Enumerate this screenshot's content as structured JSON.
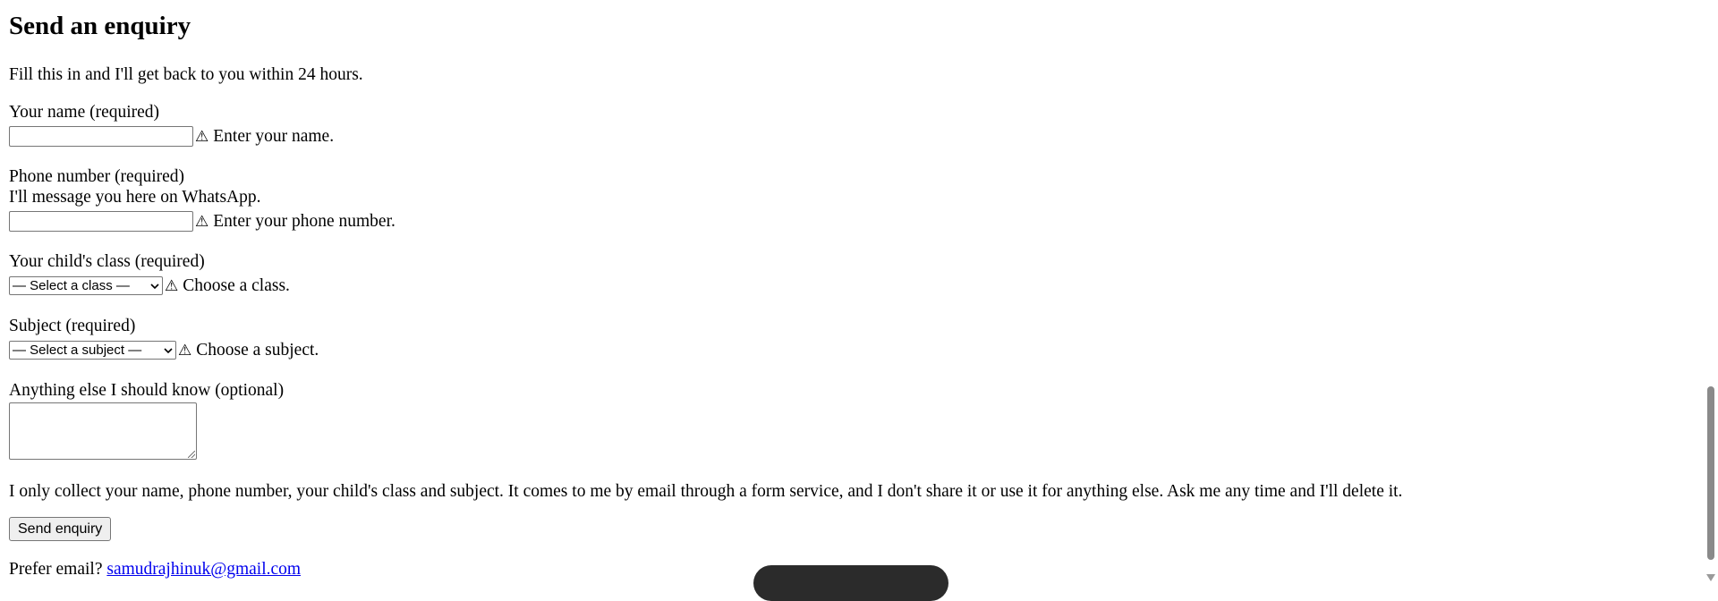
{
  "form": {
    "title": "Send an enquiry",
    "intro": "Fill this in and I'll get back to you within 24 hours.",
    "name_label": "Your name (required)",
    "name_value": "",
    "name_error": "Enter your name.",
    "phone_label": "Phone number (required)",
    "phone_hint": "I'll message you here on WhatsApp.",
    "phone_value": "",
    "phone_error": "Enter your phone number.",
    "class_label": "Your child's class (required)",
    "class_selected": "— Select a class —",
    "class_error": "Choose a class.",
    "subject_label": "Subject (required)",
    "subject_selected": "— Select a subject —",
    "subject_error": "Choose a subject.",
    "notes_label": "Anything else I should know (optional)",
    "notes_value": "",
    "privacy": "I only collect your name, phone number, your child's class and subject. It comes to me by email through a form service, and I don't share it or use it for anything else. Ask me any time and I'll delete it.",
    "submit_label": "Send enquiry",
    "email_prompt": "Prefer email?",
    "email_link": "samudrajhinuk@gmail.com"
  },
  "icons": {
    "warning": "⚠",
    "chevron": "⌄"
  },
  "colors": {
    "link": "#0000ee",
    "border": "#767676",
    "button_bg": "#efefef"
  }
}
